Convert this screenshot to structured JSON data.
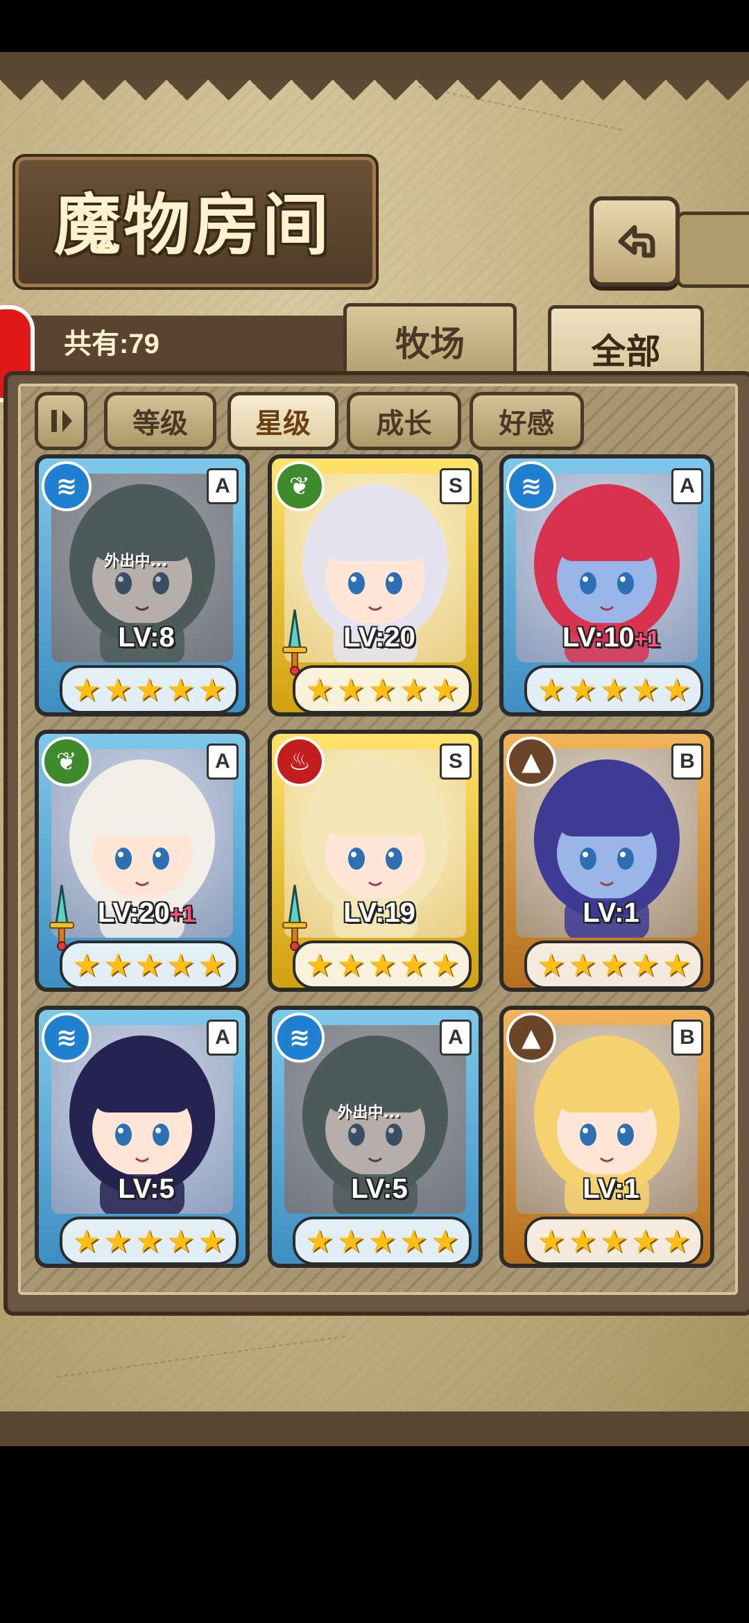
{
  "header": {
    "title": "魔物房间",
    "count_label": "共有:79",
    "back_icon": "back-arrow-icon"
  },
  "tabs": [
    {
      "label": "牧场",
      "active": false
    },
    {
      "label": "全部",
      "active": true
    }
  ],
  "filters": {
    "toggle_icon": "sort-toggle-icon",
    "items": [
      {
        "label": "等级",
        "active": false
      },
      {
        "label": "星级",
        "active": true
      },
      {
        "label": "成长",
        "active": false
      },
      {
        "label": "好感",
        "active": false
      }
    ]
  },
  "cards": [
    {
      "element": "water",
      "rank": "A",
      "level": "LV:8",
      "plus": "",
      "stars": 5,
      "frame": "blue",
      "away": "外出中...",
      "weapon": false
    },
    {
      "element": "nature",
      "rank": "S",
      "level": "LV:20",
      "plus": "",
      "stars": 5,
      "frame": "gold",
      "away": "",
      "weapon": true
    },
    {
      "element": "water",
      "rank": "A",
      "level": "LV:10",
      "plus": "+1",
      "stars": 5,
      "frame": "blue",
      "away": "",
      "weapon": false
    },
    {
      "element": "nature",
      "rank": "A",
      "level": "LV:20",
      "plus": "+1",
      "stars": 5,
      "frame": "blue",
      "away": "",
      "weapon": true
    },
    {
      "element": "fire",
      "rank": "S",
      "level": "LV:19",
      "plus": "",
      "stars": 5,
      "frame": "gold",
      "away": "",
      "weapon": true
    },
    {
      "element": "earth",
      "rank": "B",
      "level": "LV:1",
      "plus": "",
      "stars": 5,
      "frame": "bronze",
      "away": "",
      "weapon": false
    },
    {
      "element": "water",
      "rank": "A",
      "level": "LV:5",
      "plus": "",
      "stars": 5,
      "frame": "blue",
      "away": "",
      "weapon": false
    },
    {
      "element": "water",
      "rank": "A",
      "level": "LV:5",
      "plus": "",
      "stars": 5,
      "frame": "blue",
      "away": "外出中...",
      "weapon": false
    },
    {
      "element": "earth",
      "rank": "B",
      "level": "LV:1",
      "plus": "",
      "stars": 5,
      "frame": "bronze",
      "away": "",
      "weapon": false
    }
  ]
}
